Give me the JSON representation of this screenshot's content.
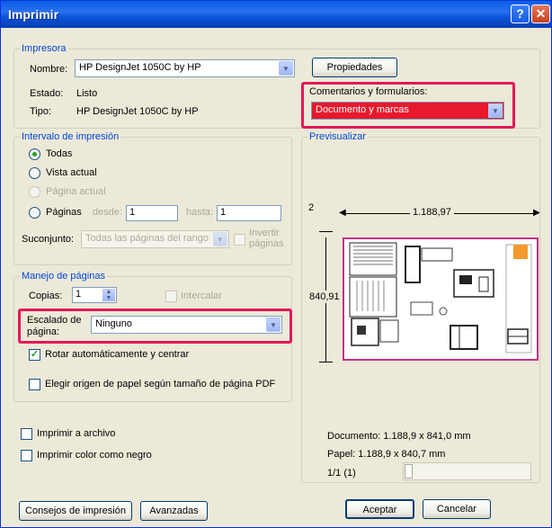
{
  "window": {
    "title": "Imprimir",
    "help_glyph": "?",
    "close_glyph": "✕"
  },
  "printer": {
    "group_label": "Impresora",
    "name_label": "Nombre:",
    "name_value": "HP DesignJet 1050C by HP",
    "properties_button": "Propiedades",
    "state_label": "Estado:",
    "state_value": "Listo",
    "type_label": "Tipo:",
    "type_value": "HP DesignJet 1050C by HP",
    "comments_label": "Comentarios y formularios:",
    "comments_value": "Documento y marcas"
  },
  "range": {
    "group_label": "Intervalo de impresión",
    "all": "Todas",
    "current_view": "Vista actual",
    "current_page": "Página actual",
    "pages": "Páginas",
    "from_label": "desde:",
    "from_value": "1",
    "to_label": "hasta:",
    "to_value": "1",
    "subset_label": "Suconjunto:",
    "subset_value": "Todas las páginas del rango",
    "invert_label_1": "Invertir",
    "invert_label_2": "páginas",
    "selected": "all"
  },
  "handling": {
    "group_label": "Manejo de páginas",
    "copies_label": "Copias:",
    "copies_value": "1",
    "collate_label": "Intercalar",
    "scaling_label_1": "Escalado de",
    "scaling_label_2": "página:",
    "scaling_value": "Ninguno",
    "auto_rotate_label": "Rotar automáticamente y centrar",
    "auto_rotate_checked": true,
    "paper_source_label": "Elegir origen de papel según tamaño de página PDF",
    "paper_source_checked": false
  },
  "options": {
    "print_to_file": "Imprimir a archivo",
    "print_color_black": "Imprimir color como negro"
  },
  "preview": {
    "group_label": "Previsualizar",
    "width_dim": "1.188,97",
    "height_dim": "840,91",
    "corner_mark": "2",
    "document_size": "Documento: 1.188,9 x 841,0 mm",
    "paper_size": "Papel: 1.188,9 x 840,7 mm",
    "page_counter": "1/1 (1)"
  },
  "buttons": {
    "tips": "Consejos de impresión",
    "advanced": "Avanzadas",
    "ok": "Aceptar",
    "cancel": "Cancelar"
  },
  "colors": {
    "highlight": "#e2185b",
    "accent": "#0046d5",
    "dropdown_red": "#e8192c"
  }
}
